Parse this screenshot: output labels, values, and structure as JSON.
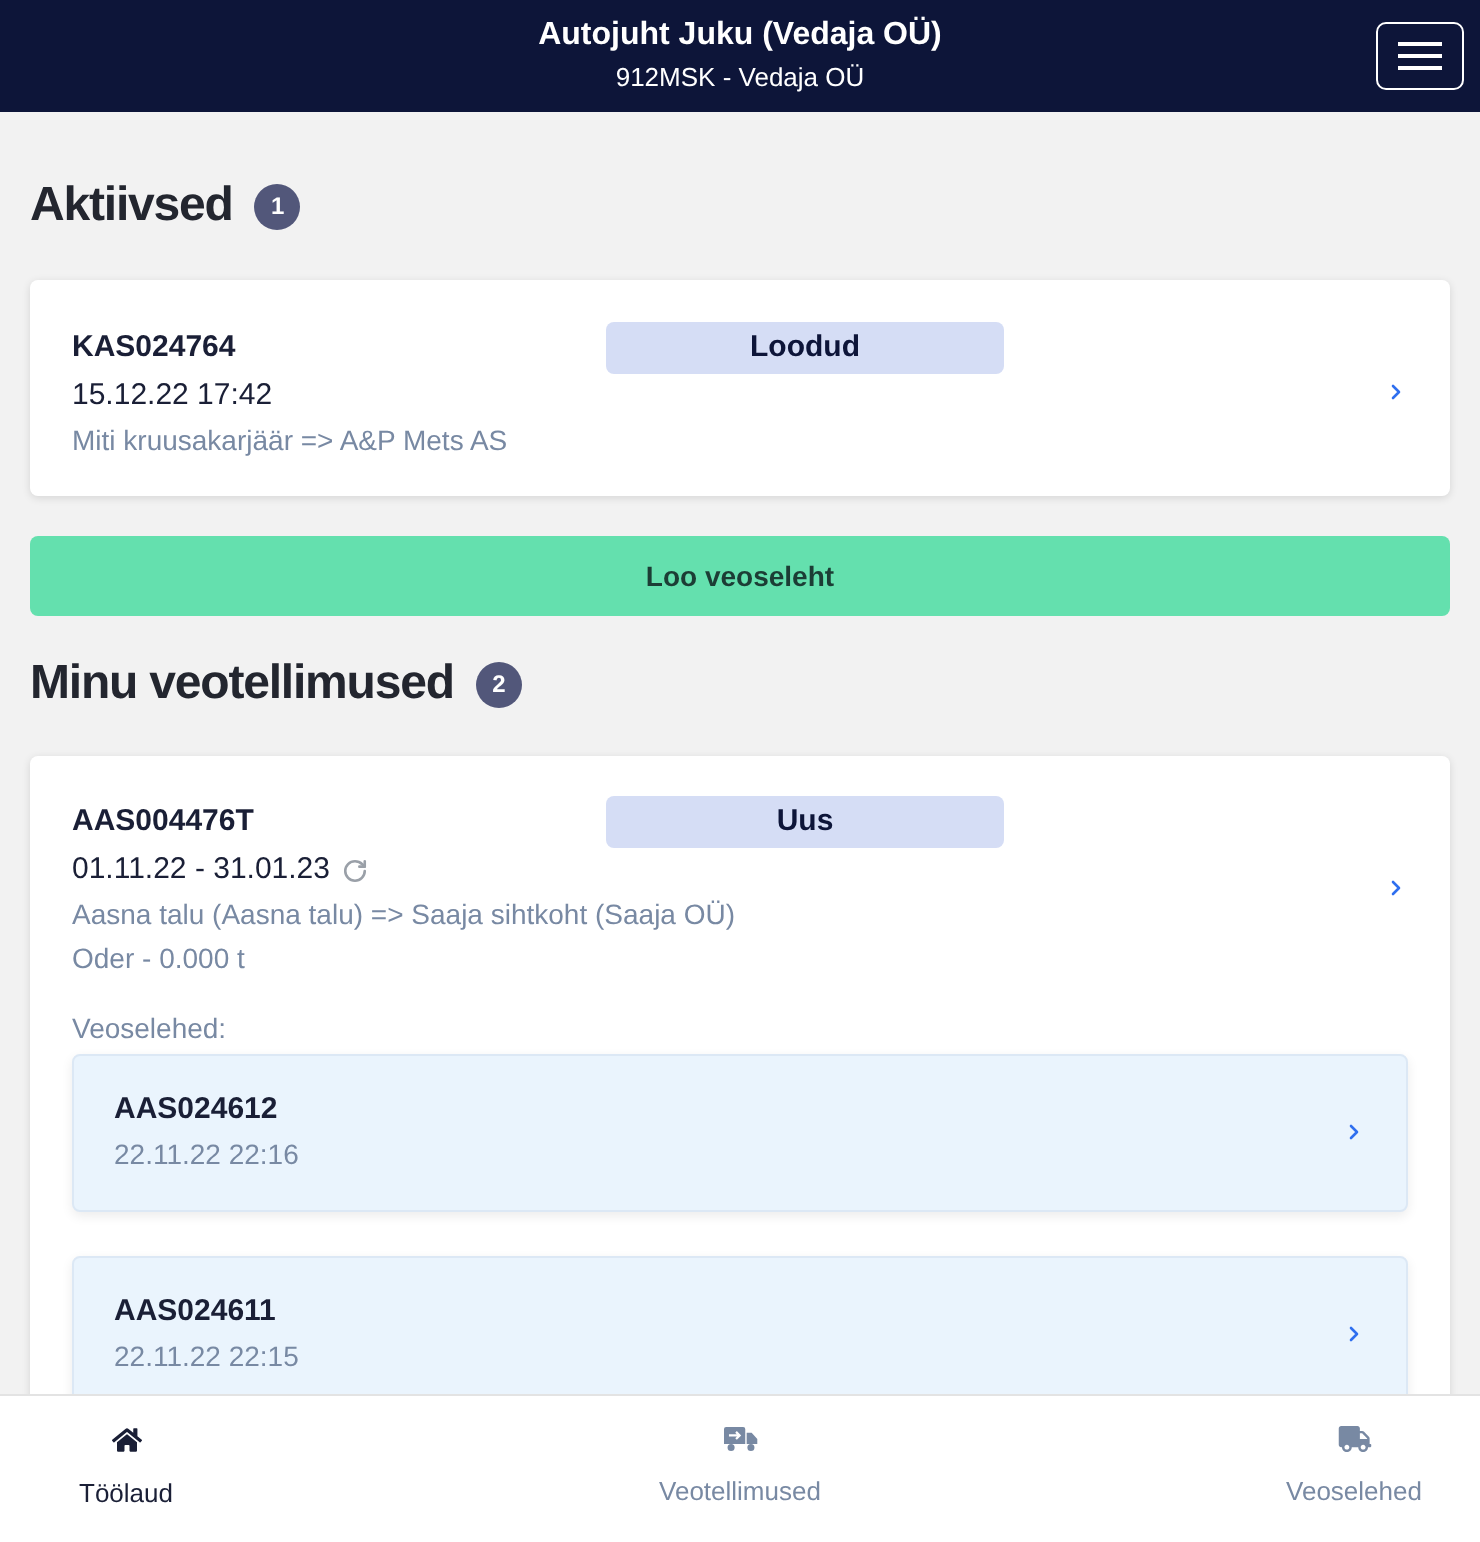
{
  "header": {
    "title": "Autojuht Juku (Vedaja OÜ)",
    "subtitle": "912MSK - Vedaja OÜ"
  },
  "active": {
    "heading": "Aktiivsed",
    "count": "1",
    "items": [
      {
        "number": "KAS024764",
        "status": "Loodud",
        "date": "15.12.22 17:42",
        "route": "Miti kruusakarjäär => A&P Mets AS"
      }
    ]
  },
  "create_button": "Loo veoseleht",
  "orders": {
    "heading": "Minu veotellimused",
    "count": "2",
    "items": [
      {
        "number": "AAS004476T",
        "status": "Uus",
        "period": "01.11.22 - 31.01.23",
        "recurring": true,
        "route": "Aasna talu (Aasna talu) => Saaja sihtkoht (Saaja OÜ)",
        "cargo": "Oder - 0.000 t",
        "waybills_label": "Veoselehed:",
        "waybills": [
          {
            "number": "AAS024612",
            "date": "22.11.22 22:16"
          },
          {
            "number": "AAS024611",
            "date": "22.11.22 22:15"
          }
        ]
      }
    ]
  },
  "bottom_nav": [
    {
      "label": "Töölaud",
      "kind": "home",
      "selected": true
    },
    {
      "label": "Veotellimused",
      "kind": "dispatch",
      "selected": false
    },
    {
      "label": "Veoselehed",
      "kind": "truck",
      "selected": false
    }
  ]
}
